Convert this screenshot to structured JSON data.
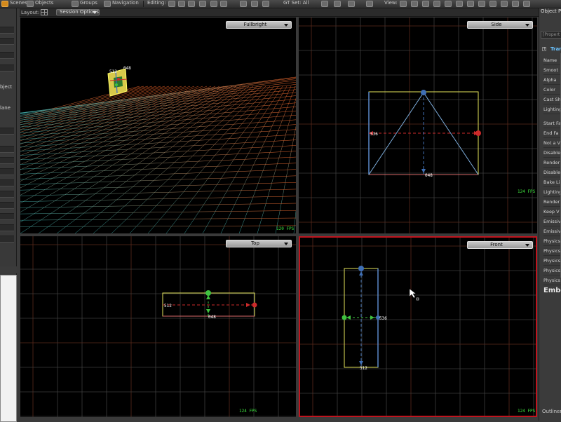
{
  "toolbar": {
    "items": [
      "Scenes",
      "Objects",
      "Groups",
      "Navigation",
      "Editing:",
      "GT Set: All"
    ],
    "view_label": "View:"
  },
  "layout": {
    "label": "Layout:",
    "session_options": "Session Options"
  },
  "left_panel": {
    "labels": [
      "",
      "",
      "",
      "",
      "",
      "bject",
      "lane"
    ]
  },
  "viewports": {
    "perspective": {
      "mode": "Fullbright",
      "fps": "120 FPS"
    },
    "side": {
      "mode": "Side",
      "fps": "124 FPS",
      "label_a": "536",
      "label_b": "048"
    },
    "top": {
      "mode": "Top",
      "fps": "124 FPS",
      "label_a": "512",
      "label_b": "048"
    },
    "front": {
      "mode": "Front",
      "fps": "124 FPS",
      "label_a": "536",
      "label_b": "512"
    },
    "perspective_labels": {
      "label_a": "048",
      "label_b": "512"
    }
  },
  "colors": {
    "grid": "#3d3d3d",
    "grid_axis": "#5a2a1c",
    "selection_border": "#c0141e",
    "yellow": "#e3e35a",
    "blue": "#5b88c9",
    "red": "#cc2a2a",
    "green": "#3fc23f",
    "fps": "#3ee23e"
  },
  "right_panel": {
    "title": "Object Pr",
    "search_placeholder": "[Propert",
    "section": "Tran",
    "rows": [
      "Name",
      "Smoot",
      "Alpha",
      "Color",
      "Cast Sh",
      "Lighting",
      "Start Fa",
      "End Fa",
      "Not a V",
      "Disable",
      "Render",
      "Disable",
      "Bake Li",
      "Lighting",
      "Render",
      "Keep V",
      "Emissive",
      "Emissive",
      "Physics",
      "Physics",
      "Physics",
      "Physics",
      "Physics"
    ],
    "embed": "Embe",
    "outliner": "Outliner"
  }
}
